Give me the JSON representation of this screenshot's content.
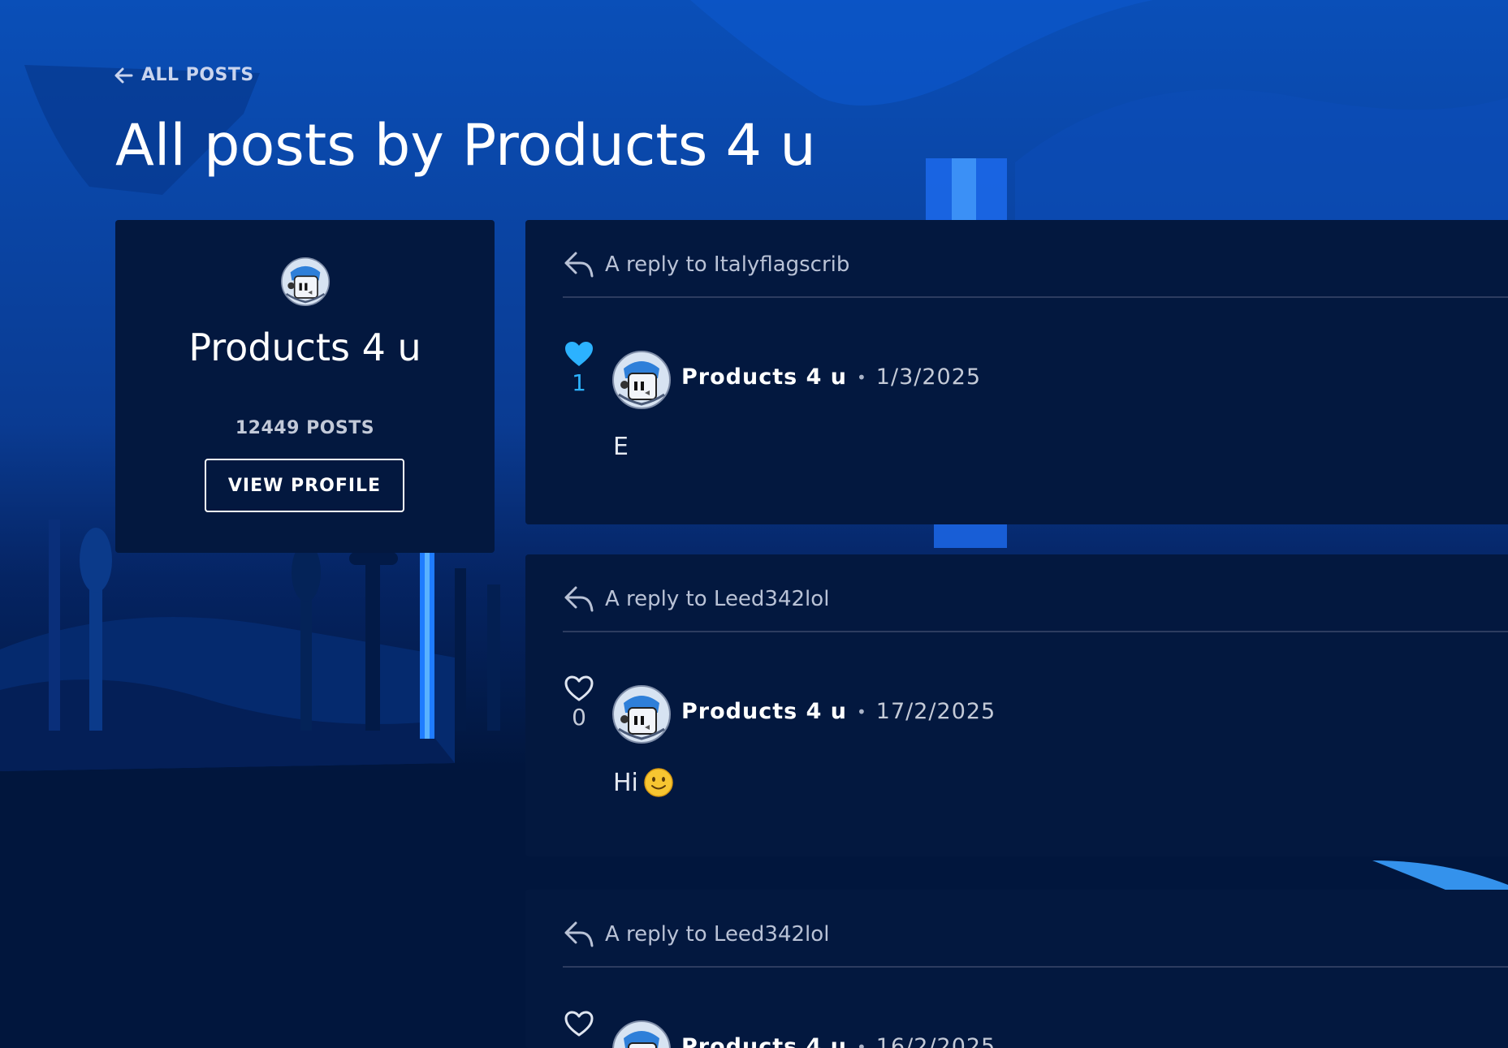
{
  "nav": {
    "back_label": "ALL POSTS"
  },
  "page": {
    "title": "All posts by Products 4 u"
  },
  "profile": {
    "name": "Products 4 u",
    "post_count": "12449 POSTS",
    "view_label": "VIEW PROFILE"
  },
  "posts": [
    {
      "reply_to": "A reply to Italyflagscrib",
      "likes": "1",
      "liked": true,
      "author": "Products 4 u",
      "date": "1/3/2025",
      "body": "E"
    },
    {
      "reply_to": "A reply to Leed342lol",
      "likes": "0",
      "liked": false,
      "author": "Products 4 u",
      "date": "17/2/2025",
      "body": "Hi"
    },
    {
      "reply_to": "A reply to Leed342lol",
      "likes": "",
      "liked": false,
      "author": "Products 4 u",
      "date": "16/2/2025",
      "body": ""
    }
  ],
  "colors": {
    "background": "#01163d",
    "card": "#03183f",
    "accent": "#2cb2ff",
    "text_muted": "#b9c2d6"
  },
  "icons": {
    "back": "arrow-left-icon",
    "reply": "reply-arrow-icon",
    "like_filled": "heart-filled-icon",
    "like_outline": "heart-outline-icon",
    "emoji": "smiling-face-emoji"
  }
}
